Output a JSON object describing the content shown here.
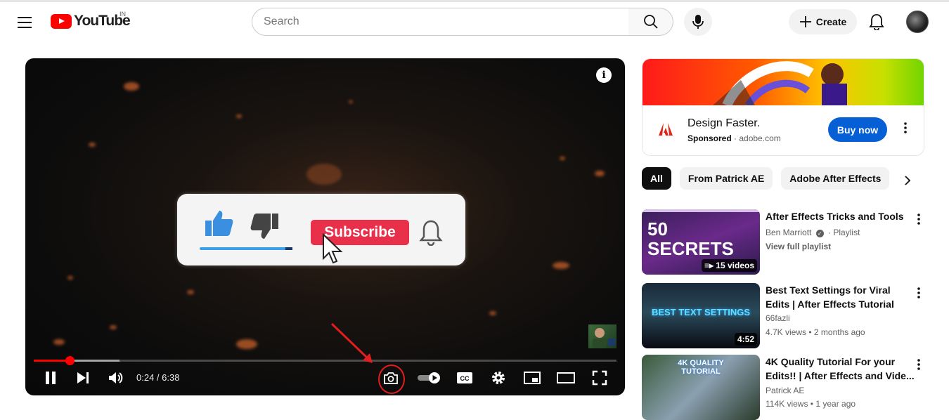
{
  "header": {
    "logo_text": "YouTube",
    "country": "IN",
    "search_placeholder": "Search",
    "create_label": "Create"
  },
  "player": {
    "current_time": "0:24",
    "duration": "6:38",
    "time_display": "0:24 / 6:38",
    "progress_fraction": 0.062,
    "buffered_fraction": 0.147,
    "overlay": {
      "subscribe_label": "Subscribe"
    }
  },
  "ad": {
    "title": "Design Faster.",
    "sponsored_label": "Sponsored",
    "domain": "adobe.com",
    "cta_label": "Buy now"
  },
  "chips": [
    {
      "label": "All",
      "active": true
    },
    {
      "label": "From Patrick AE",
      "active": false
    },
    {
      "label": "Adobe After Effects",
      "active": false
    }
  ],
  "recommendations": [
    {
      "title": "After Effects Tricks and Tools",
      "channel": "Ben Marriott",
      "channel_suffix": "Playlist",
      "link": "View full playlist",
      "badge": "15 videos",
      "thumb_text": "50 SECRETS"
    },
    {
      "title": "Best Text Settings for Viral Edits | After Effects Tutorial",
      "channel": "66fazli",
      "meta": "4.7K views • 2 months ago",
      "badge": "4:52",
      "thumb_text": "BEST TEXT SETTINGS"
    },
    {
      "title": "4K Quality Tutorial For your Edits!! | After Effects and Vide...",
      "channel": "Patrick AE",
      "meta": "114K views • 1 year ago",
      "thumb_text": "4K QUALITY TUTORIAL"
    }
  ]
}
